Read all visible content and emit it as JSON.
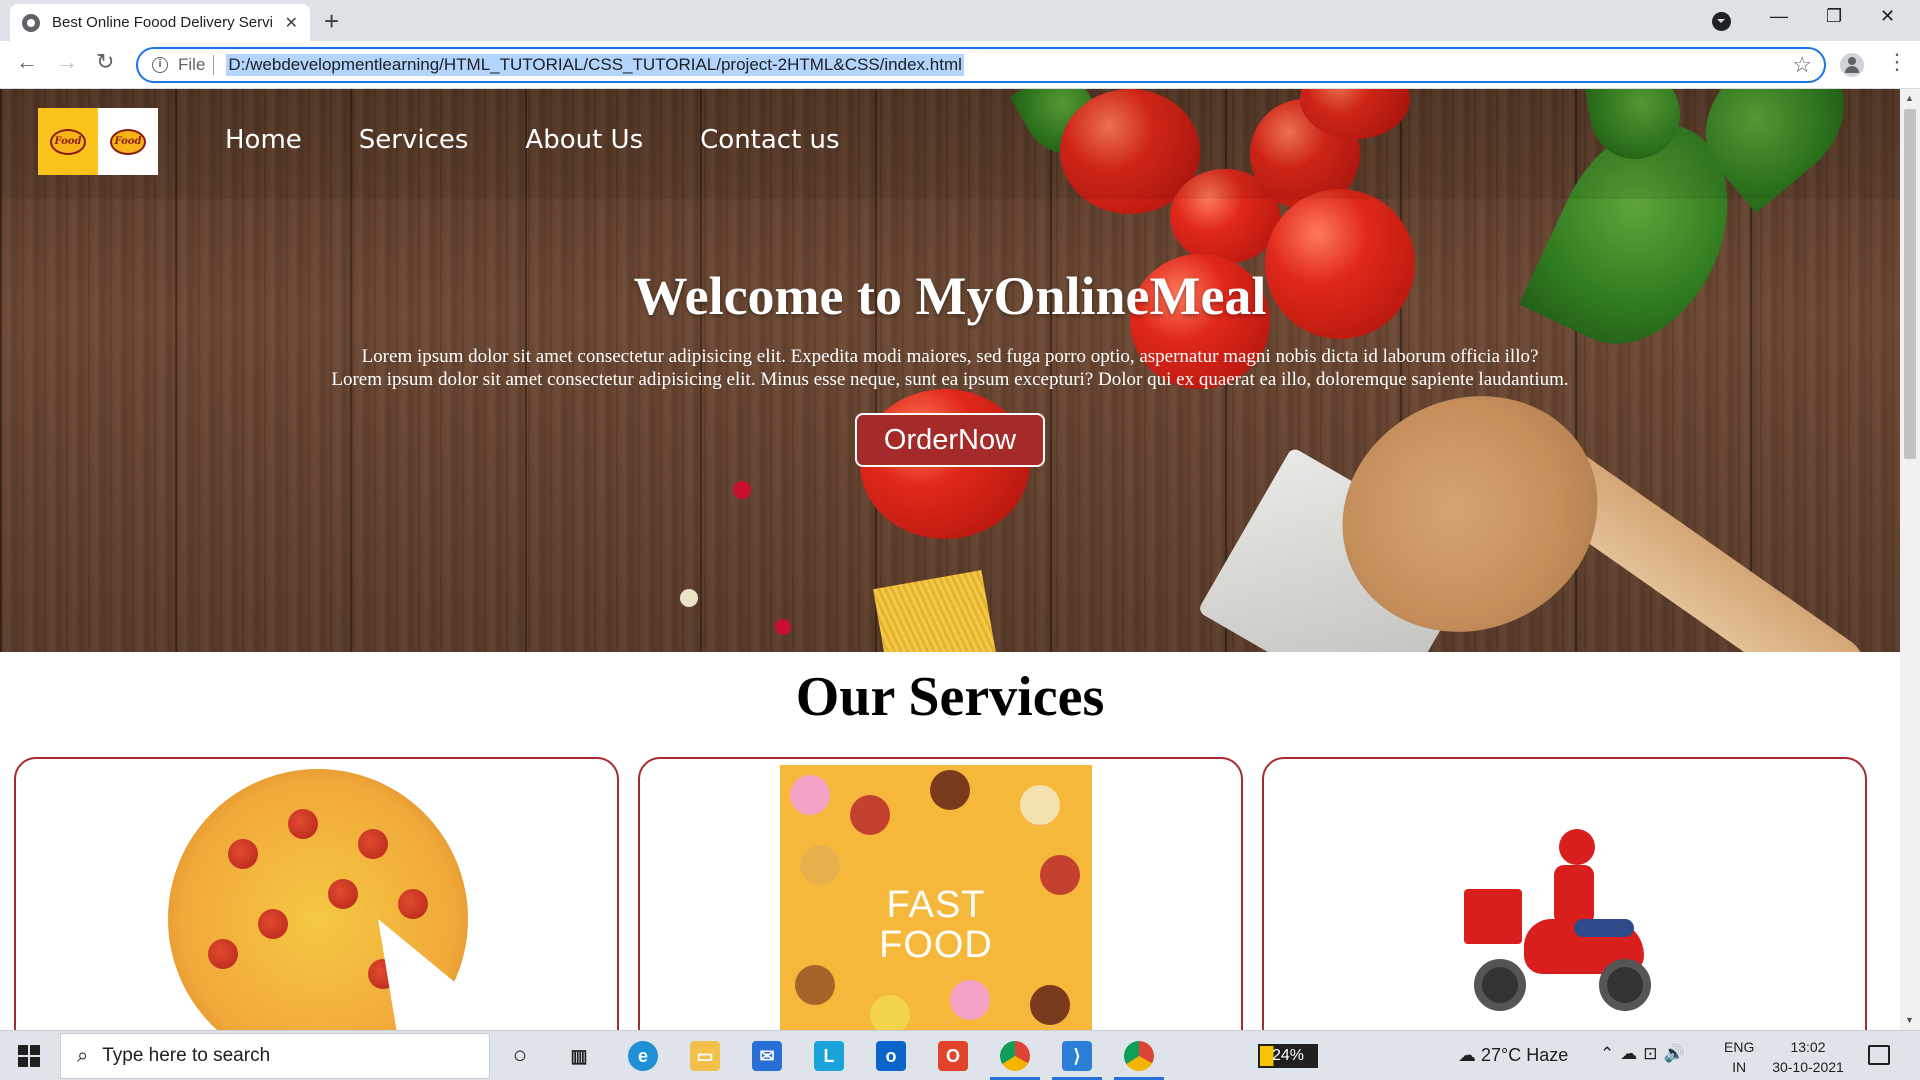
{
  "browser": {
    "tab_title": "Best Online Foood Delivery Servi",
    "file_label": "File",
    "url": "D:/webdevelopmentlearning/HTML_TUTORIAL/CSS_TUTORIAL/project-2HTML&CSS/index.html"
  },
  "navbar": {
    "logo_text": "Food",
    "links": [
      "Home",
      "Services",
      "About Us",
      "Contact us"
    ]
  },
  "hero": {
    "title": "Welcome to MyOnlineMeal",
    "line1": "Lorem ipsum dolor sit amet consectetur adipisicing elit. Expedita modi maiores, sed fuga porro optio, aspernatur magni nobis dicta id laborum officia illo?",
    "line2": "Lorem ipsum dolor sit amet consectetur adipisicing elit. Minus esse neque, sunt ea ipsum excepturi? Dolor qui ex quaerat ea illo, doloremque sapiente laudantium.",
    "button_label": "OrderNow"
  },
  "services": {
    "title": "Our Services",
    "fast_food_line1": "FAST",
    "fast_food_line2": "FOOD"
  },
  "taskbar": {
    "search_placeholder": "Type here to search",
    "battery_label": "24%",
    "weather": "27°C  Haze",
    "lang_line1": "ENG",
    "lang_line2": "IN",
    "time": "13:02",
    "date": "30-10-2021"
  },
  "colors": {
    "accent": "#a52a2a",
    "logo_yellow": "#f9c31c",
    "omnibox_focus": "#1a73e8"
  }
}
